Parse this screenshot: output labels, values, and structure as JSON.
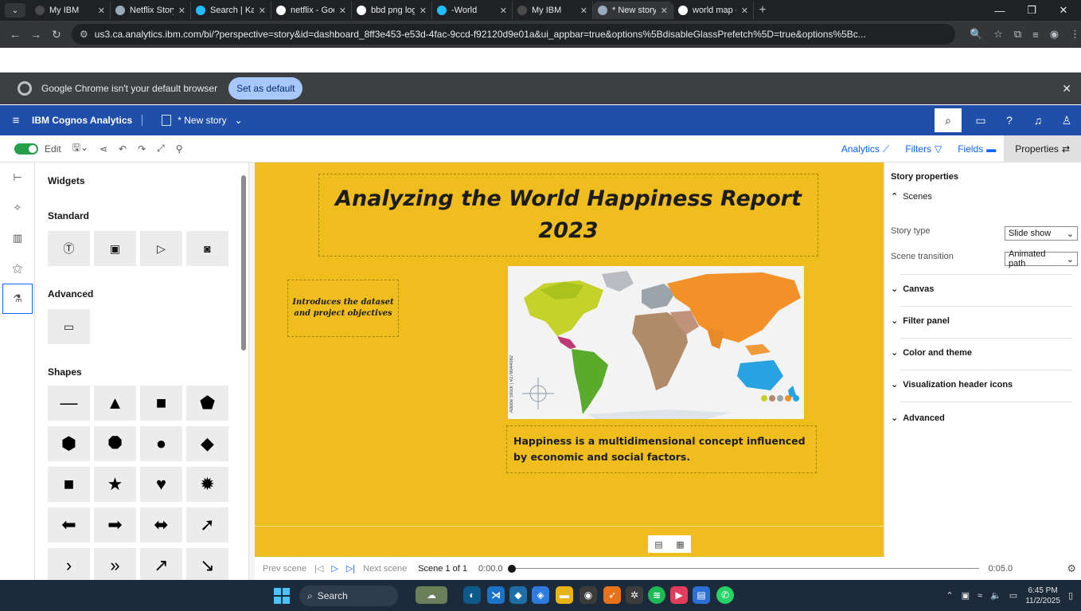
{
  "browser": {
    "tabs": [
      {
        "label": "My IBM",
        "favicon": "ibm-icon",
        "color": "#4a4a4a"
      },
      {
        "label": "Netflix Story",
        "favicon": "netflix-story-icon",
        "color": "#9ab"
      },
      {
        "label": "Search | Kagg",
        "favicon": "kaggle-icon",
        "color": "#20beff"
      },
      {
        "label": "netflix - Goo",
        "favicon": "google-icon",
        "color": "#fff"
      },
      {
        "label": "bbd png logo",
        "favicon": "google-icon",
        "color": "#fff"
      },
      {
        "label": "-World",
        "favicon": "kaggle-icon",
        "color": "#20beff"
      },
      {
        "label": "My IBM",
        "favicon": "ibm-icon",
        "color": "#4a4a4a"
      },
      {
        "label": "* New story",
        "favicon": "cognos-icon",
        "color": "#9ab",
        "active": true
      },
      {
        "label": "world map -",
        "favicon": "google-icon",
        "color": "#fff"
      }
    ],
    "url": "us3.ca.analytics.ibm.com/bi/?perspective=story&id=dashboard_8ff3e453-e53d-4fac-9ccd-f92120d9e01a&ui_appbar=true&options%5BdisableGlassPrefetch%5D=true&options%5Bc...",
    "infobar_text": "Google Chrome isn't your default browser",
    "set_default_label": "Set as default"
  },
  "app": {
    "brand": "IBM Cognos Analytics",
    "story_name": "* New story",
    "accent": "#1f4fa8"
  },
  "toolbar": {
    "edit_label": "Edit",
    "analytics_label": "Analytics",
    "filters_label": "Filters",
    "fields_label": "Fields",
    "properties_label": "Properties"
  },
  "widgets": {
    "title": "Widgets",
    "standard_heading": "Standard",
    "advanced_heading": "Advanced",
    "shapes_heading": "Shapes",
    "shapes": [
      "—",
      "▲",
      "■",
      "⬟",
      "⬢",
      "⯃",
      "●",
      "◆",
      "■",
      "★",
      "♥",
      "✹",
      "⬅",
      "➡",
      "⬌",
      "➚",
      "›",
      "»",
      "↗",
      "↘"
    ]
  },
  "canvas": {
    "background": "#efbd1e",
    "title": "Analyzing the World Happiness Report 2023",
    "intro": "Introduces the dataset and project objectives",
    "caption": "Happiness is a multidimensional concept influenced by economic and social factors.",
    "map_watermark": "Adobe Stock | #278044082"
  },
  "timeline": {
    "prev": "Prev scene",
    "next": "Next scene",
    "scene": "Scene 1 of 1",
    "start_time": "0:00.0",
    "end_time": "0:05.0"
  },
  "properties": {
    "title": "Story properties",
    "scenes": "Scenes",
    "story_type_label": "Story type",
    "story_type_value": "Slide show",
    "scene_transition_label": "Scene transition",
    "scene_transition_value": "Animated path",
    "canvas": "Canvas",
    "filter_panel": "Filter panel",
    "color_theme": "Color and theme",
    "viz_header_icons": "Visualization header icons",
    "advanced": "Advanced"
  },
  "taskbar": {
    "search_label": "Search",
    "time": "6:45 PM",
    "date": "11/2/2025"
  }
}
